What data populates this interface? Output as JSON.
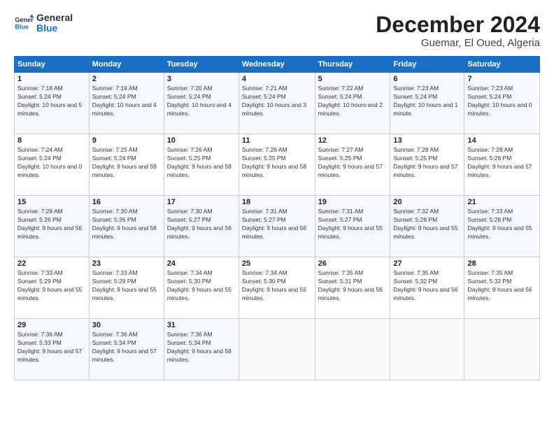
{
  "header": {
    "logo_line1": "General",
    "logo_line2": "Blue",
    "month": "December 2024",
    "location": "Guemar, El Oued, Algeria"
  },
  "days_of_week": [
    "Sunday",
    "Monday",
    "Tuesday",
    "Wednesday",
    "Thursday",
    "Friday",
    "Saturday"
  ],
  "weeks": [
    [
      {
        "day": "1",
        "sunrise": "7:18 AM",
        "sunset": "5:24 PM",
        "daylight": "10 hours and 5 minutes."
      },
      {
        "day": "2",
        "sunrise": "7:19 AM",
        "sunset": "5:24 PM",
        "daylight": "10 hours and 4 minutes."
      },
      {
        "day": "3",
        "sunrise": "7:20 AM",
        "sunset": "5:24 PM",
        "daylight": "10 hours and 4 minutes."
      },
      {
        "day": "4",
        "sunrise": "7:21 AM",
        "sunset": "5:24 PM",
        "daylight": "10 hours and 3 minutes."
      },
      {
        "day": "5",
        "sunrise": "7:22 AM",
        "sunset": "5:24 PM",
        "daylight": "10 hours and 2 minutes."
      },
      {
        "day": "6",
        "sunrise": "7:23 AM",
        "sunset": "5:24 PM",
        "daylight": "10 hours and 1 minute."
      },
      {
        "day": "7",
        "sunrise": "7:23 AM",
        "sunset": "5:24 PM",
        "daylight": "10 hours and 0 minutes."
      }
    ],
    [
      {
        "day": "8",
        "sunrise": "7:24 AM",
        "sunset": "5:24 PM",
        "daylight": "10 hours and 0 minutes."
      },
      {
        "day": "9",
        "sunrise": "7:25 AM",
        "sunset": "5:24 PM",
        "daylight": "9 hours and 59 minutes."
      },
      {
        "day": "10",
        "sunrise": "7:26 AM",
        "sunset": "5:25 PM",
        "daylight": "9 hours and 58 minutes."
      },
      {
        "day": "11",
        "sunrise": "7:26 AM",
        "sunset": "5:25 PM",
        "daylight": "9 hours and 58 minutes."
      },
      {
        "day": "12",
        "sunrise": "7:27 AM",
        "sunset": "5:25 PM",
        "daylight": "9 hours and 57 minutes."
      },
      {
        "day": "13",
        "sunrise": "7:28 AM",
        "sunset": "5:25 PM",
        "daylight": "9 hours and 57 minutes."
      },
      {
        "day": "14",
        "sunrise": "7:28 AM",
        "sunset": "5:26 PM",
        "daylight": "9 hours and 57 minutes."
      }
    ],
    [
      {
        "day": "15",
        "sunrise": "7:29 AM",
        "sunset": "5:26 PM",
        "daylight": "9 hours and 56 minutes."
      },
      {
        "day": "16",
        "sunrise": "7:30 AM",
        "sunset": "5:26 PM",
        "daylight": "9 hours and 56 minutes."
      },
      {
        "day": "17",
        "sunrise": "7:30 AM",
        "sunset": "5:27 PM",
        "daylight": "9 hours and 56 minutes."
      },
      {
        "day": "18",
        "sunrise": "7:31 AM",
        "sunset": "5:27 PM",
        "daylight": "9 hours and 56 minutes."
      },
      {
        "day": "19",
        "sunrise": "7:31 AM",
        "sunset": "5:27 PM",
        "daylight": "9 hours and 55 minutes."
      },
      {
        "day": "20",
        "sunrise": "7:32 AM",
        "sunset": "5:28 PM",
        "daylight": "9 hours and 55 minutes."
      },
      {
        "day": "21",
        "sunrise": "7:33 AM",
        "sunset": "5:28 PM",
        "daylight": "9 hours and 55 minutes."
      }
    ],
    [
      {
        "day": "22",
        "sunrise": "7:33 AM",
        "sunset": "5:29 PM",
        "daylight": "9 hours and 55 minutes."
      },
      {
        "day": "23",
        "sunrise": "7:33 AM",
        "sunset": "5:29 PM",
        "daylight": "9 hours and 55 minutes."
      },
      {
        "day": "24",
        "sunrise": "7:34 AM",
        "sunset": "5:30 PM",
        "daylight": "9 hours and 55 minutes."
      },
      {
        "day": "25",
        "sunrise": "7:34 AM",
        "sunset": "5:30 PM",
        "daylight": "9 hours and 55 minutes."
      },
      {
        "day": "26",
        "sunrise": "7:35 AM",
        "sunset": "5:31 PM",
        "daylight": "9 hours and 56 minutes."
      },
      {
        "day": "27",
        "sunrise": "7:35 AM",
        "sunset": "5:32 PM",
        "daylight": "9 hours and 56 minutes."
      },
      {
        "day": "28",
        "sunrise": "7:35 AM",
        "sunset": "5:32 PM",
        "daylight": "9 hours and 56 minutes."
      }
    ],
    [
      {
        "day": "29",
        "sunrise": "7:36 AM",
        "sunset": "5:33 PM",
        "daylight": "9 hours and 57 minutes."
      },
      {
        "day": "30",
        "sunrise": "7:36 AM",
        "sunset": "5:34 PM",
        "daylight": "9 hours and 57 minutes."
      },
      {
        "day": "31",
        "sunrise": "7:36 AM",
        "sunset": "5:34 PM",
        "daylight": "9 hours and 58 minutes."
      },
      null,
      null,
      null,
      null
    ]
  ],
  "labels": {
    "sunrise": "Sunrise:",
    "sunset": "Sunset:",
    "daylight": "Daylight:"
  }
}
